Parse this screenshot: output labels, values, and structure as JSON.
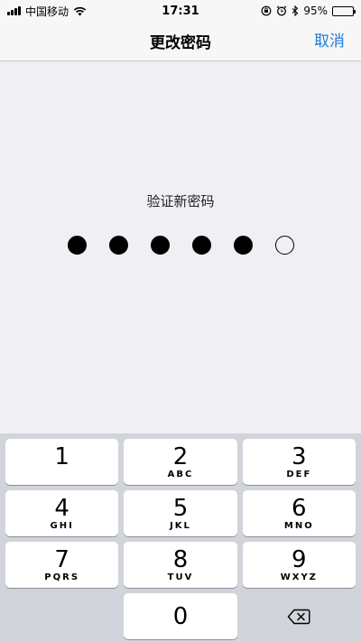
{
  "status_bar": {
    "carrier": "中国移动",
    "time": "17:31",
    "battery_percent": "95%",
    "battery_level": 0.95,
    "icons": [
      "signal-icon",
      "wifi-icon",
      "orientation-lock-icon",
      "alarm-icon",
      "bluetooth-icon",
      "battery-icon"
    ]
  },
  "nav": {
    "title": "更改密码",
    "cancel_label": "取消",
    "accent_color": "#1c7cd5"
  },
  "passcode": {
    "prompt": "验证新密码",
    "length": 6,
    "entered": 5
  },
  "keypad": {
    "keys": [
      {
        "digit": "1",
        "letters": ""
      },
      {
        "digit": "2",
        "letters": "ABC"
      },
      {
        "digit": "3",
        "letters": "DEF"
      },
      {
        "digit": "4",
        "letters": "GHI"
      },
      {
        "digit": "5",
        "letters": "JKL"
      },
      {
        "digit": "6",
        "letters": "MNO"
      },
      {
        "digit": "7",
        "letters": "PQRS"
      },
      {
        "digit": "8",
        "letters": "TUV"
      },
      {
        "digit": "9",
        "letters": "WXYZ"
      },
      {
        "digit": "0",
        "letters": ""
      }
    ],
    "delete_icon": "backspace-icon"
  }
}
